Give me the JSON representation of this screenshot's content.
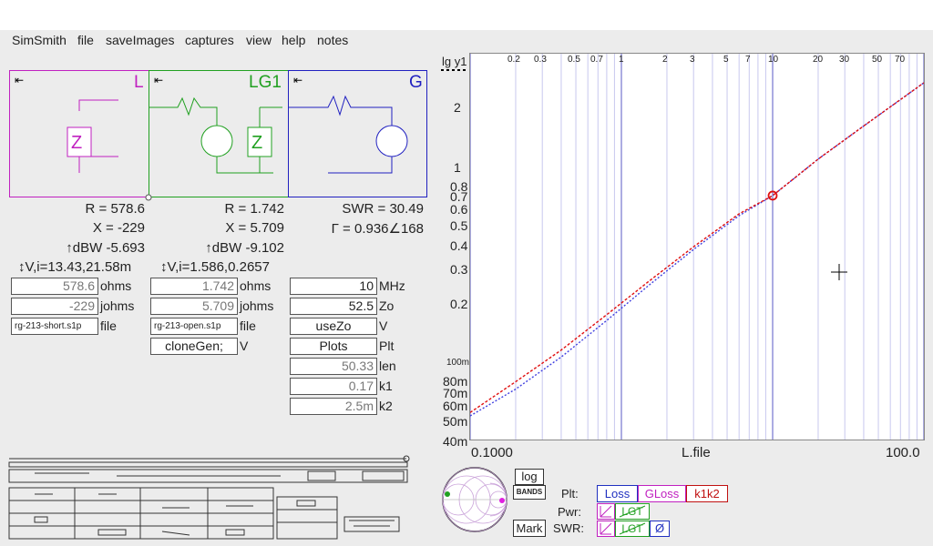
{
  "menu": [
    "SimSmith",
    "file",
    "saveImages",
    "captures",
    "view",
    "help",
    "notes"
  ],
  "schematic": {
    "segments": [
      {
        "label": "L",
        "color": "#c020c0"
      },
      {
        "label": "LG1",
        "color": "#20a020"
      },
      {
        "label": "G",
        "color": "#2020c0"
      }
    ],
    "arrow": "⇤",
    "z_glyph": "Z"
  },
  "readouts": {
    "L": {
      "R": "R = 578.6",
      "X": "X = -229",
      "dBW": "↑dBW -5.693",
      "Vi": "↕V,i=13.43,21.58m"
    },
    "LG1": {
      "R": "R = 1.742",
      "X": "X = 5.709",
      "dBW": "↑dBW -9.102",
      "Vi": "↕V,i=1.586,0.2657"
    },
    "G": {
      "SWR": "SWR = 30.49",
      "Gamma": "Γ = 0.936∠168"
    }
  },
  "fields": {
    "L": [
      {
        "value": "578.6",
        "unit": "ohms"
      },
      {
        "value": "-229",
        "unit": "johms"
      },
      {
        "value": "rg-213-short.s1p",
        "unit": "file"
      }
    ],
    "LG1": [
      {
        "value": "1.742",
        "unit": "ohms"
      },
      {
        "value": "5.709",
        "unit": "johms"
      },
      {
        "value": "rg-213-open.s1p",
        "unit": "file"
      },
      {
        "value": "cloneGen;",
        "unit": "V"
      }
    ],
    "G": [
      {
        "value": "10",
        "unit": "MHz"
      },
      {
        "value": "52.5",
        "unit": "Zo"
      },
      {
        "value": "useZo",
        "unit": "V"
      },
      {
        "value": "Plots",
        "unit": "Plt"
      },
      {
        "value": "50.33",
        "unit": "len"
      },
      {
        "value": "0.17",
        "unit": "k1"
      },
      {
        "value": "2.5m",
        "unit": "k2"
      }
    ]
  },
  "plot": {
    "ylabel": "lg y1",
    "xlabel": "L.file",
    "top_ticks": [
      "0.2",
      "0.3",
      "0.5",
      "0.7",
      "1",
      "2",
      "3",
      "5",
      "7",
      "10",
      "20",
      "30",
      "50",
      "70"
    ],
    "x_ticks": [
      "0.1000",
      "100.0"
    ],
    "y_ticks": [
      "2",
      "1",
      "0.8",
      "0.7",
      "0.6",
      "0.5",
      "0.4",
      "0.3",
      "0.2",
      "100m",
      "80m",
      "70m",
      "60m",
      "50m",
      "40m"
    ],
    "line_colors": {
      "red": "#e01010",
      "blue": "#4040e0"
    }
  },
  "controls": {
    "log": "log",
    "bands": "BANDS",
    "mark": "Mark",
    "plt_label": "Plt:",
    "pwr_label": "Pwr:",
    "swr_label": "SWR:",
    "plt_buttons": [
      {
        "label": "Loss",
        "color": "#2030c0"
      },
      {
        "label": "GLoss",
        "color": "#c020c0"
      },
      {
        "label": "k1k2",
        "color": "#c01010"
      }
    ],
    "lgt": "LGT",
    "phi": "Ø"
  }
}
